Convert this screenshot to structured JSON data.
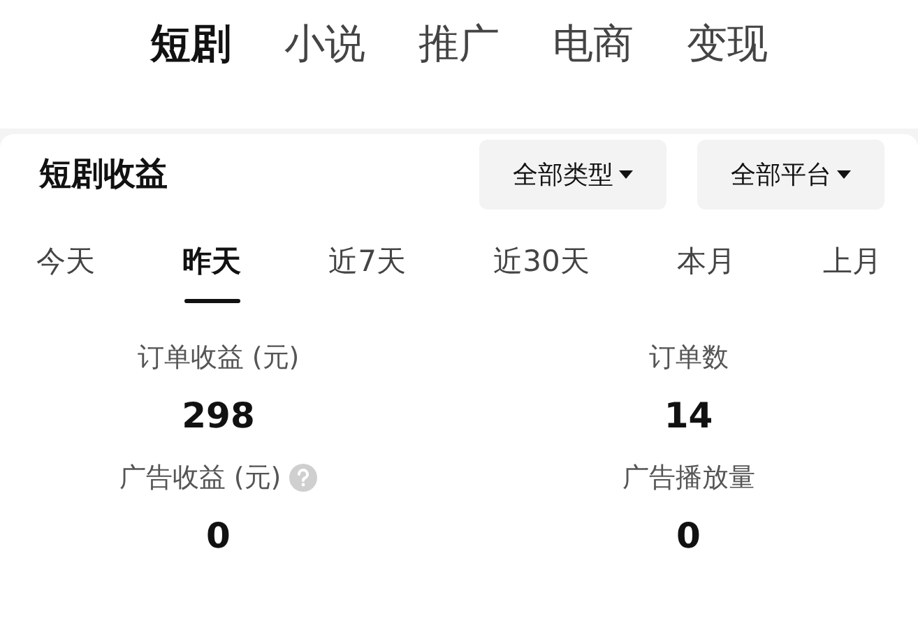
{
  "top_tabs": [
    {
      "label": "短剧",
      "selected": true
    },
    {
      "label": "小说",
      "selected": false
    },
    {
      "label": "推广",
      "selected": false
    },
    {
      "label": "电商",
      "selected": false
    },
    {
      "label": "变现",
      "selected": false
    }
  ],
  "card": {
    "title": "短剧收益",
    "filters": [
      "全部类型",
      "全部平台"
    ],
    "periods": [
      {
        "label": "今天",
        "selected": false
      },
      {
        "label": "昨天",
        "selected": true
      },
      {
        "label": "近7天",
        "selected": false
      },
      {
        "label": "近30天",
        "selected": false
      },
      {
        "label": "本月",
        "selected": false
      },
      {
        "label": "上月",
        "selected": false
      }
    ],
    "stats": [
      {
        "label": "订单收益 (元)",
        "value": "298",
        "help": false
      },
      {
        "label": "订单数",
        "value": "14",
        "help": false
      },
      {
        "label": "广告收益 (元)",
        "value": "0",
        "help": true
      },
      {
        "label": "广告播放量",
        "value": "0",
        "help": false
      }
    ]
  }
}
